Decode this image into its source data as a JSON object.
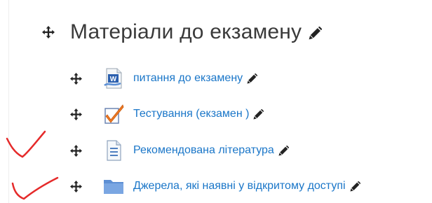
{
  "section": {
    "title": "Матеріали до екзамену"
  },
  "activities": [
    {
      "label": "питання до екзамену",
      "icon": "word-document-icon"
    },
    {
      "label": "Тестування (екзамен )",
      "icon": "quiz-checkmark-icon"
    },
    {
      "label": "Рекомендована література",
      "icon": "page-icon"
    },
    {
      "label": "Джерела, які наявні у відкритому доступі",
      "icon": "folder-icon"
    }
  ],
  "colors": {
    "link": "#1a76c8",
    "title": "#3a3a3a",
    "annotation": "#e52a2a"
  }
}
